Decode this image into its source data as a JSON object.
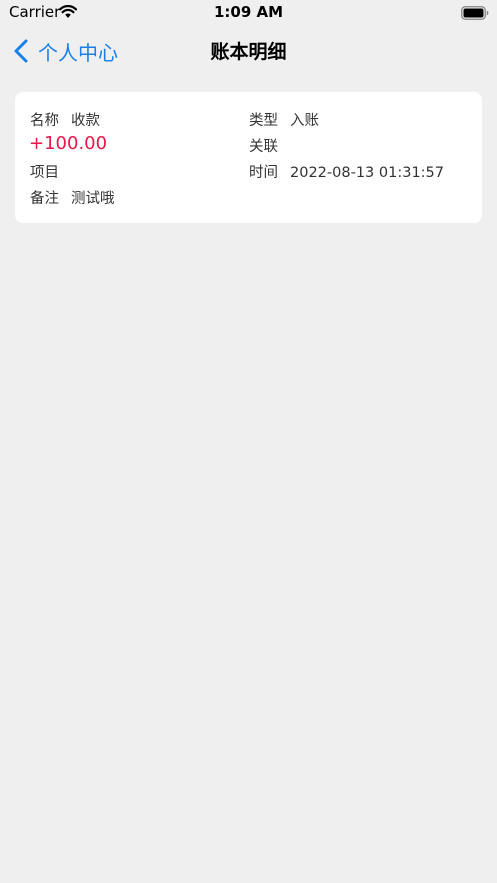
{
  "status_bar": {
    "carrier": "Carrier",
    "time": "1:09 AM",
    "wifi_icon": "wifi-icon",
    "battery_icon": "battery-icon"
  },
  "nav": {
    "back_label": "个人中心",
    "back_icon": "chevron-left-icon",
    "title": "账本明细",
    "accent_color": "#1a7fe6"
  },
  "record": {
    "name_label": "名称",
    "name_value": "收款",
    "type_label": "类型",
    "type_value": "入账",
    "amount": "+100.00",
    "amount_color": "#e8174a",
    "link_label": "关联",
    "link_value": "",
    "project_label": "项目",
    "project_value": "",
    "time_label": "时间",
    "time_value": "2022-08-13 01:31:57",
    "note_label": "备注",
    "note_value": "测试哦"
  }
}
